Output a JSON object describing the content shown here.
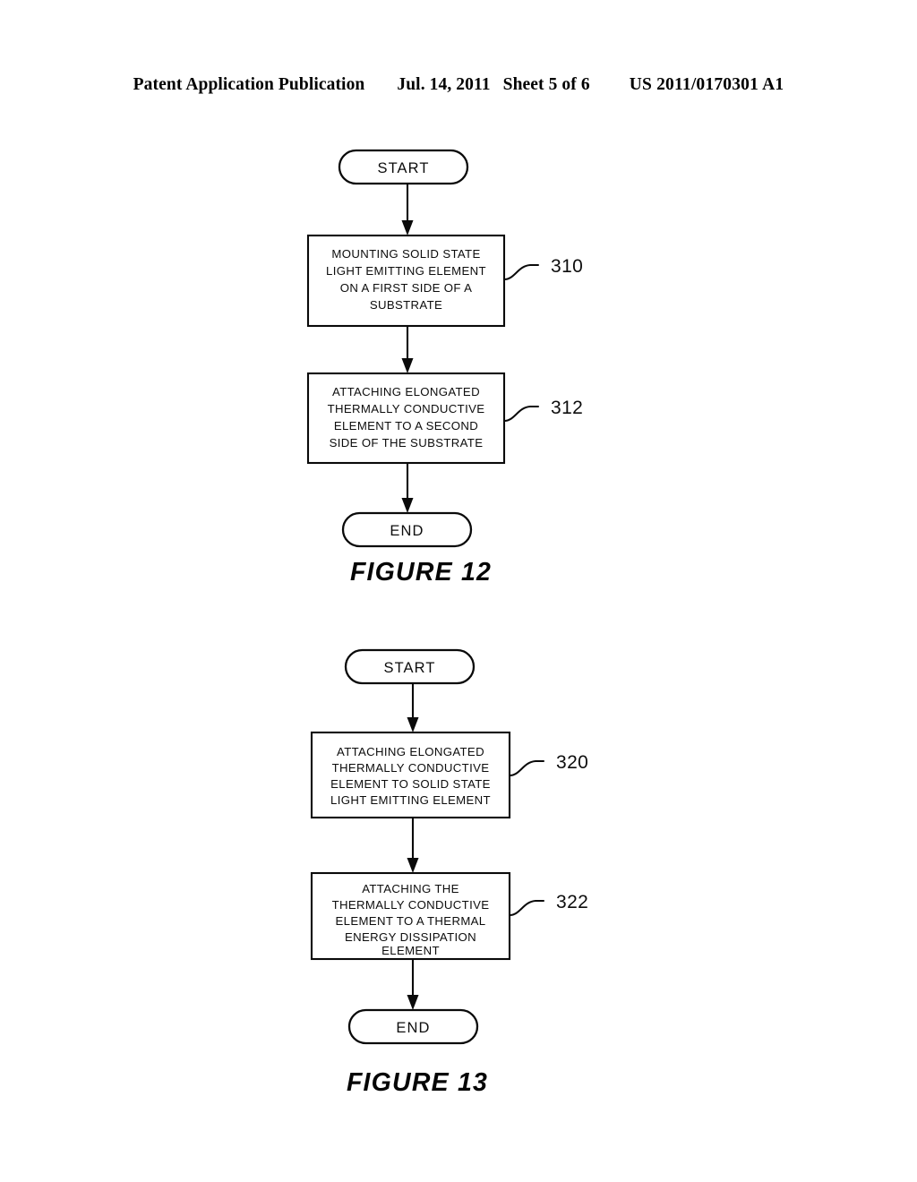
{
  "header": {
    "left": "Patent Application Publication",
    "date": "Jul. 14, 2011",
    "sheet": "Sheet 5 of 6",
    "publication_number": "US 2011/0170301 A1"
  },
  "figures": [
    {
      "caption": "FIGURE 12",
      "start_label": "START",
      "end_label": "END",
      "steps": [
        {
          "ref": "310",
          "lines": [
            "MOUNTING SOLID STATE",
            "LIGHT EMITTING ELEMENT",
            "ON A FIRST SIDE OF A",
            "SUBSTRATE"
          ]
        },
        {
          "ref": "312",
          "lines": [
            "ATTACHING ELONGATED",
            "THERMALLY CONDUCTIVE",
            "ELEMENT TO A SECOND",
            "SIDE OF THE SUBSTRATE"
          ]
        }
      ]
    },
    {
      "caption": "FIGURE 13",
      "start_label": "START",
      "end_label": "END",
      "steps": [
        {
          "ref": "320",
          "lines": [
            "ATTACHING ELONGATED",
            "THERMALLY CONDUCTIVE",
            "ELEMENT TO SOLID STATE",
            "LIGHT EMITTING ELEMENT"
          ]
        },
        {
          "ref": "322",
          "lines": [
            "ATTACHING THE",
            "THERMALLY CONDUCTIVE",
            "ELEMENT TO A THERMAL",
            "ENERGY DISSIPATION",
            "ELEMENT"
          ]
        }
      ]
    }
  ],
  "colors": {
    "ink": "#0a0a0a",
    "paper": "#ffffff"
  }
}
